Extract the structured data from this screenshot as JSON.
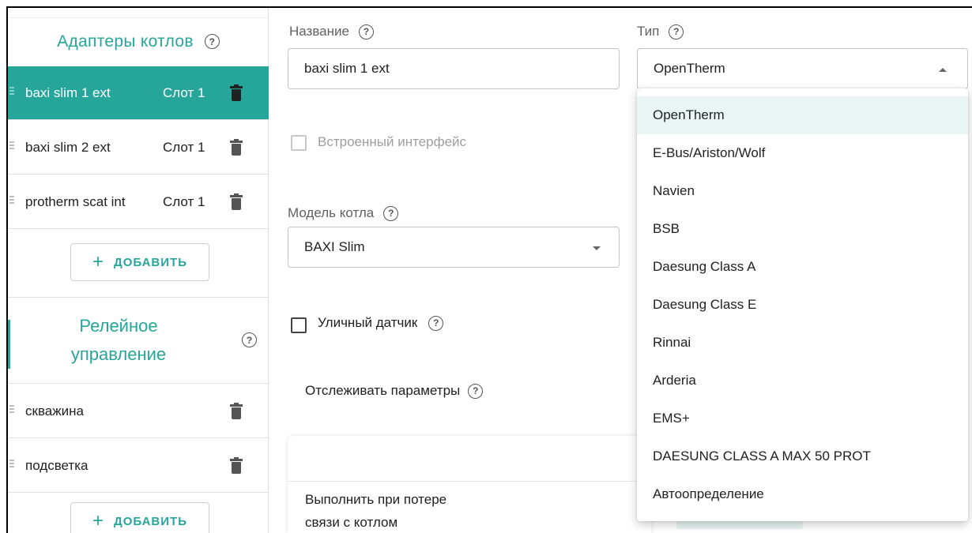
{
  "left_panel": {
    "adapters_title": "Адаптеры котлов",
    "adapters": [
      {
        "name": "baxi slim 1 ext",
        "slot": "Слот 1",
        "active": true
      },
      {
        "name": "baxi slim 2 ext",
        "slot": "Слот 1",
        "active": false
      },
      {
        "name": "protherm scat int",
        "slot": "Слот 1",
        "active": false
      }
    ],
    "add_label": "ДОБАВИТЬ",
    "relay_title": "Релейное управление",
    "relays": [
      {
        "name": "скважина"
      },
      {
        "name": "подсветка"
      }
    ]
  },
  "form": {
    "name_label": "Название",
    "name_value": "baxi slim 1 ext",
    "type_label": "Тип",
    "type_value": "OpenTherm",
    "builtin_interface_label": "Встроенный интерфейс",
    "model_label": "Модель котла",
    "model_value": "BAXI Slim",
    "outdoor_sensor_label": "Уличный датчик",
    "track_params_label": "Отслеживать параметры",
    "on_loss_line1": "Выполнить при потере",
    "on_loss_line2": "связи с котлом"
  },
  "type_menu": {
    "options": [
      "OpenTherm",
      "E-Bus/Ariston/Wolf",
      "Navien",
      "BSB",
      "Daesung Class A",
      "Daesung Class E",
      "Rinnai",
      "Arderia",
      "EMS+",
      "DAESUNG CLASS A MAX 50 PROT",
      "Автоопределение"
    ],
    "selected": "OpenTherm"
  },
  "colors": {
    "accent": "#26a69a",
    "selected_row_bg": "#26a69a",
    "menu_selected_bg": "#eaf6f5"
  },
  "icons": [
    "help-icon",
    "trash-icon",
    "drag-handle-icon",
    "plus-icon",
    "chevron-down-icon",
    "chevron-up-icon"
  ]
}
